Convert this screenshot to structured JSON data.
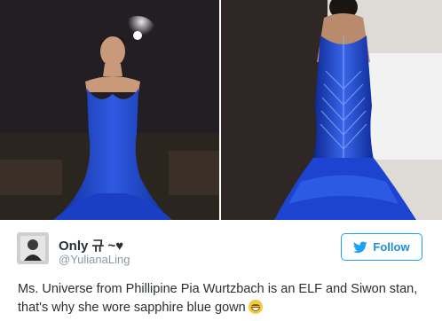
{
  "photos": [
    {
      "subject": "woman in blue strapless mermaid gown on stage"
    },
    {
      "subject": "back view of beaded blue mermaid gown"
    }
  ],
  "author": {
    "display_name": "Only 규 ~♥",
    "handle": "@YulianaLing"
  },
  "follow_button": {
    "label": "Follow",
    "icon": "twitter-bird-icon"
  },
  "tweet": {
    "text": "Ms. Universe from Phillipine Pia Wurtzbach is an ELF and Siwon stan, that's why she wore sapphire blue gown",
    "emoji": "grinning-face-icon"
  },
  "colors": {
    "accent": "#1da1f2",
    "text": "#292f33",
    "muted": "#8899a6",
    "gown": "#1f44c8"
  }
}
